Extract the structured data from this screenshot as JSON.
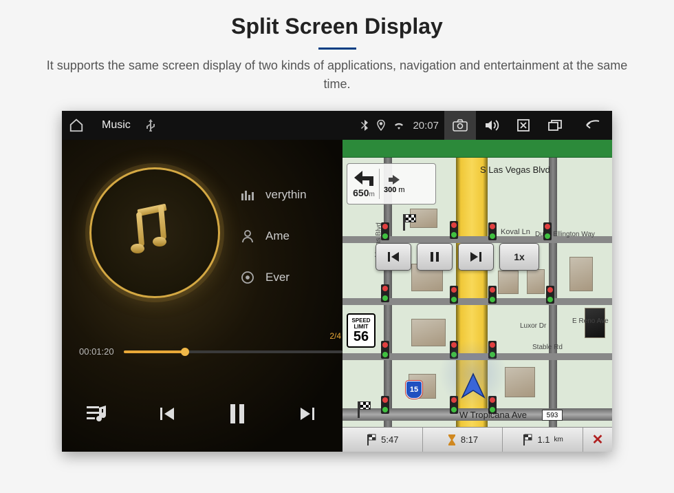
{
  "page": {
    "title": "Split Screen Display",
    "subtitle": "It supports the same screen display of two kinds of applications, navigation and entertainment at the same time."
  },
  "statusbar": {
    "app_label": "Music",
    "usb_label": "Ψ",
    "time": "20:07"
  },
  "music": {
    "tracks": {
      "t1": "verythin",
      "t2": "Ame",
      "t3": "Ever"
    },
    "elapsed": "00:01:20",
    "page_indicator": "2/4"
  },
  "map": {
    "streets": {
      "s_las_vegas": "S Las Vegas Blvd",
      "koval": "Koval Ln",
      "duke": "Duke Ellington Way",
      "luxor": "Luxor Dr",
      "stable": "Stable Rd",
      "reno": "E Reno Ave",
      "tropicana": "W Tropicana Ave",
      "vegas_blvd_side": "Vegas Blvd"
    },
    "turn": {
      "primary_distance": "650",
      "primary_unit": "m",
      "secondary_distance": "300",
      "secondary_unit": "m"
    },
    "speed_limit": {
      "label_top": "SPEED",
      "label_mid": "LIMIT",
      "value": "56"
    },
    "overlay": {
      "speed_multiplier": "1x"
    },
    "shields": {
      "i15": "15"
    },
    "route_badge": "593",
    "bottombar": {
      "eta": "5:47",
      "remaining": "8:17",
      "distance": "1.1",
      "distance_unit": "km"
    }
  }
}
